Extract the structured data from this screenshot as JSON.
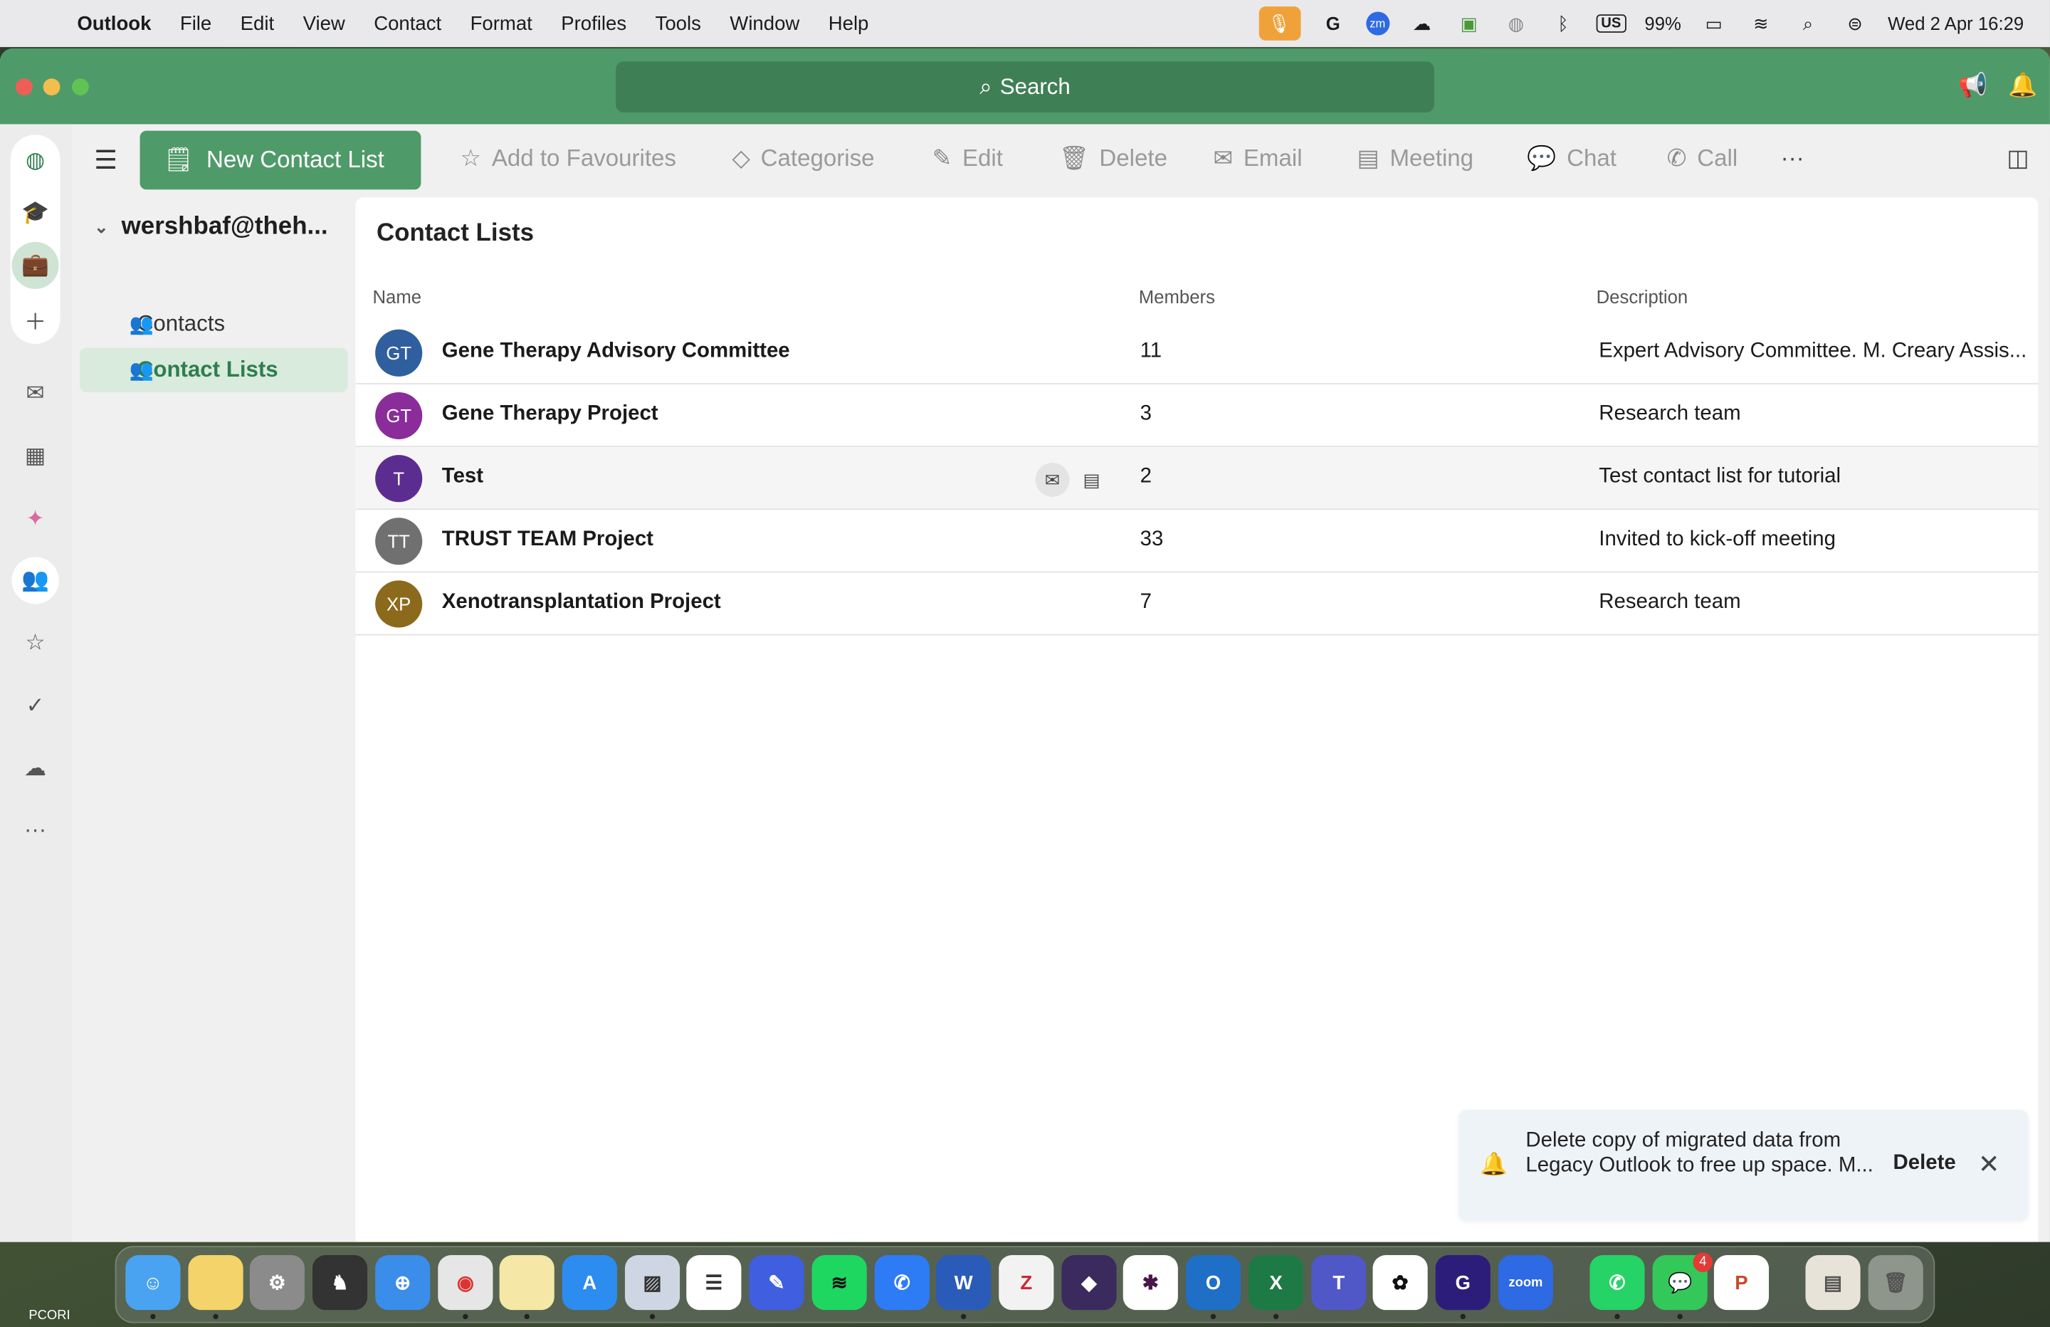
{
  "menubar": {
    "app": "Outlook",
    "items": [
      "File",
      "Edit",
      "View",
      "Contact",
      "Format",
      "Profiles",
      "Tools",
      "Window",
      "Help"
    ],
    "battery": "99%",
    "keyboard": "US",
    "datetime": "Wed 2 Apr  16:29"
  },
  "titlebar": {
    "search_label": "Search"
  },
  "toolbar": {
    "new_label": "New Contact List",
    "add_fav": "Add to Favourites",
    "categorise": "Categorise",
    "edit": "Edit",
    "delete": "Delete",
    "email": "Email",
    "meeting": "Meeting",
    "chat": "Chat",
    "call": "Call",
    "more": "···"
  },
  "folders": {
    "account": "wershbaf@theh...",
    "items": [
      {
        "label": "Contacts",
        "icon": "people-icon"
      },
      {
        "label": "Contact Lists",
        "icon": "people-filled-icon"
      }
    ]
  },
  "main": {
    "title": "Contact Lists",
    "columns": {
      "name": "Name",
      "members": "Members",
      "description": "Description"
    },
    "rows": [
      {
        "initials": "GT",
        "color": "#2f5f9e",
        "name": "Gene Therapy Advisory Committee",
        "members": "11",
        "description": "Expert Advisory Committee.  M. Creary Assis..."
      },
      {
        "initials": "GT",
        "color": "#8a2d9b",
        "name": "Gene Therapy Project",
        "members": "3",
        "description": "Research team"
      },
      {
        "initials": "T",
        "color": "#5b2d91",
        "name": "Test",
        "members": "2",
        "description": "Test contact list for tutorial"
      },
      {
        "initials": "TT",
        "color": "#707070",
        "name": "TRUST TEAM Project",
        "members": "33",
        "description": "Invited to kick-off meeting"
      },
      {
        "initials": "XP",
        "color": "#8b6a1c",
        "name": "Xenotransplantation Project",
        "members": "7",
        "description": "Research team"
      }
    ]
  },
  "notification": {
    "message": "Delete copy of migrated data from Legacy Outlook to free up space. M...",
    "action": "Delete"
  },
  "dock": {
    "label": "PCORI",
    "zoom_label": "zoom",
    "messages_badge": "4"
  },
  "colors": {
    "accent": "#4f9a69",
    "selected_bg": "#d9ebdc"
  }
}
